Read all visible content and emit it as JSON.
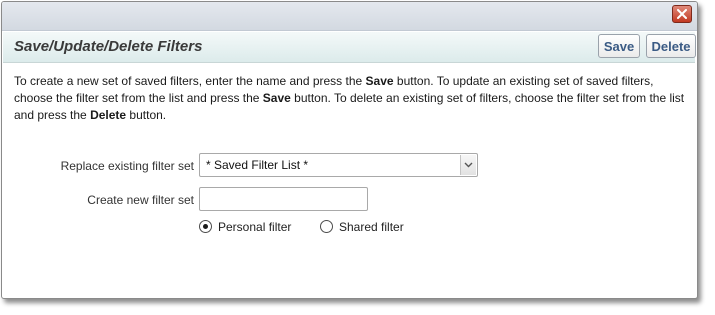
{
  "dialog": {
    "header_title": "Save/Update/Delete Filters",
    "save_label": "Save",
    "delete_label": "Delete",
    "close_icon": "close-icon"
  },
  "description": {
    "t1": "To create a new set of saved filters, enter the name and press the ",
    "b1": "Save",
    "t2": " button. To update an existing set of saved filters, choose the filter set from the list and press the ",
    "b2": "Save",
    "t3": " button. To delete an existing set of filters, choose the filter set from the list and press the ",
    "b3": "Delete",
    "t4": " button."
  },
  "form": {
    "replace_label": "Replace existing filter set",
    "replace_selected": "* Saved Filter List *",
    "create_label": "Create new filter set",
    "create_value": "",
    "personal_label": "Personal filter",
    "shared_label": "Shared filter",
    "selected_scope": "personal"
  },
  "colors": {
    "close_button": "#c23a22",
    "header_background": "#dcebeb",
    "button_text": "#3b5b85"
  }
}
